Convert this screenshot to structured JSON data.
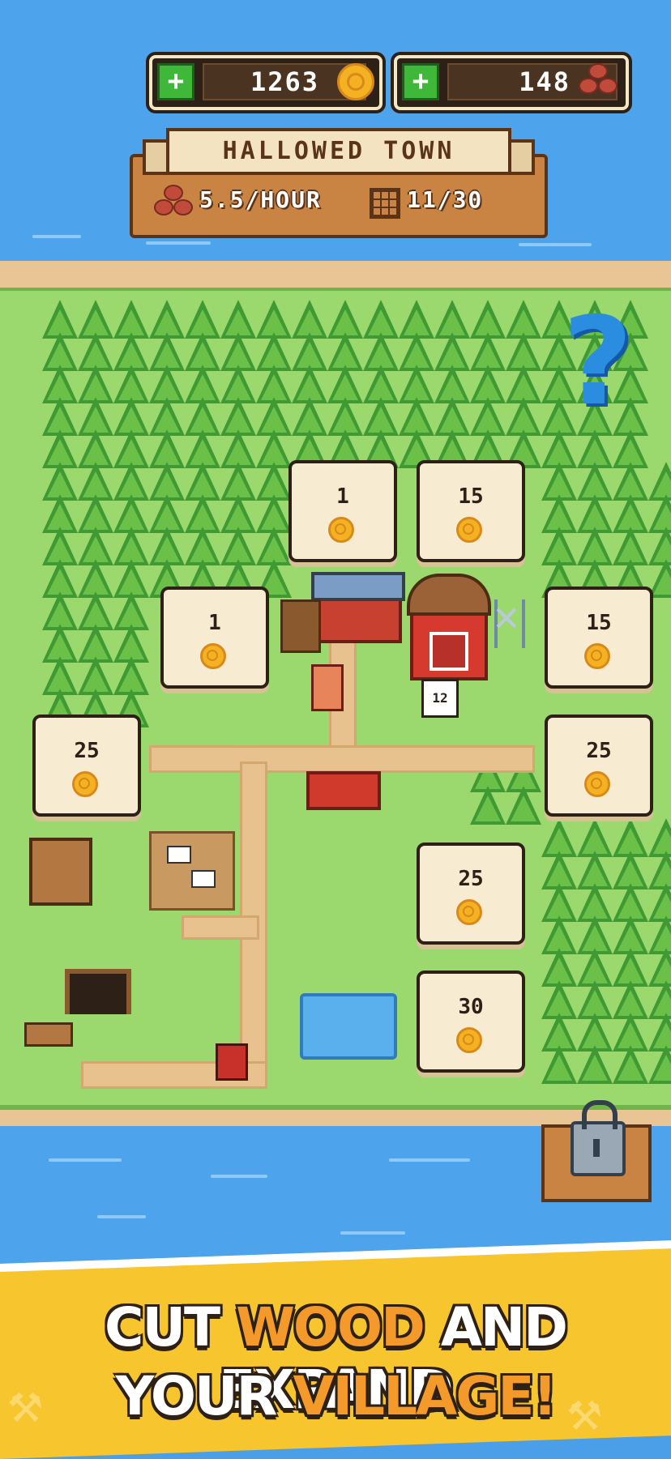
{
  "currency": {
    "coins": "1263",
    "wood": "148",
    "add_label": "+"
  },
  "town": {
    "name": "HALLOWED TOWN",
    "rate": "5.5/HOUR",
    "plots": "11/30"
  },
  "plots": [
    {
      "price": "1"
    },
    {
      "price": "15"
    },
    {
      "price": "1"
    },
    {
      "price": "15"
    },
    {
      "price": "25"
    },
    {
      "price": "25"
    },
    {
      "price": "25"
    },
    {
      "price": "30"
    }
  ],
  "characters": {
    "player_number": "12"
  },
  "mystery": {
    "symbol": "?"
  },
  "promo": {
    "line1_a": "CUT ",
    "line1_b": "WOOD",
    "line1_c": " AND EXPAND",
    "line2_a": "YOUR ",
    "line2_b": "VILLAGE!"
  },
  "colors": {
    "water": "#4ea4ec",
    "grass": "#9bd86d",
    "sand": "#e9c596",
    "coin": "#f4b222",
    "promo": "#f7c52d",
    "highlight": "#f39a2b"
  }
}
